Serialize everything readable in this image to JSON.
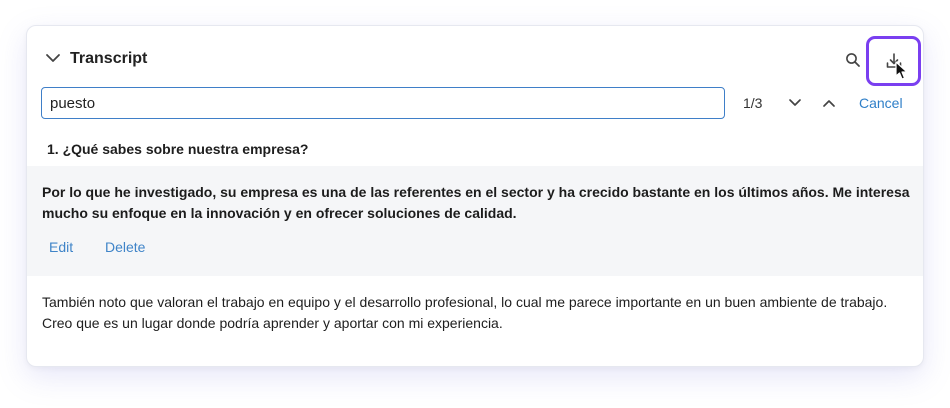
{
  "panel": {
    "title": "Transcript",
    "icons": {
      "collapse": "chevron-down-icon",
      "search": "search-icon",
      "download": "download-icon"
    },
    "accent_color": "#7a3ff0"
  },
  "search": {
    "value": "puesto",
    "match_count": "1/3",
    "cancel_label": "Cancel",
    "link_color": "#2f7fc8"
  },
  "question": {
    "text": "1. ¿Qué sabes sobre nuestra empresa?"
  },
  "answer": {
    "text": "Por lo que he investigado, su empresa es una de las referentes en el sector y ha crecido bastante en los últimos años. Me interesa mucho su enfoque en la innovación y en ofrecer soluciones de calidad.",
    "edit_label": "Edit",
    "delete_label": "Delete"
  },
  "continuation": {
    "text": "También noto que valoran el trabajo en equipo y el desarrollo profesional, lo cual me parece importante en un buen ambiente de trabajo. Creo que es un lugar donde podría aprender y aportar con mi experiencia."
  }
}
